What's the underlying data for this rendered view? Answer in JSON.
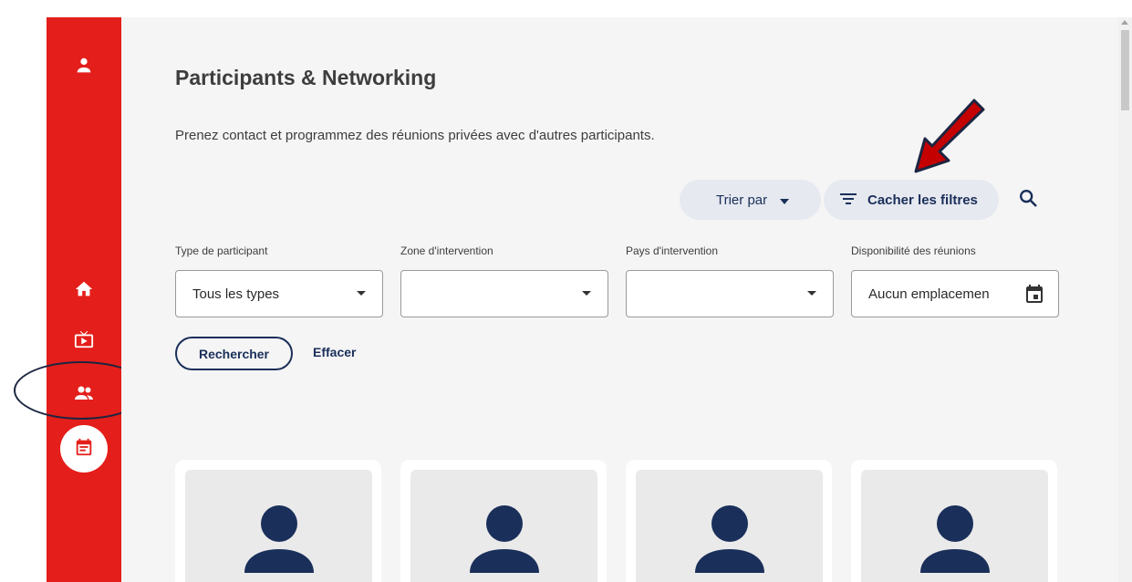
{
  "colors": {
    "brand_red": "#e41e1a",
    "navy": "#1a2f5a",
    "pill_bg": "#e6e9f0",
    "annotation_arrow": "#c40000"
  },
  "sidebar": {
    "icons": [
      "person-icon",
      "home-icon",
      "tv-icon",
      "people-icon",
      "calendar-icon"
    ],
    "active": "calendar-icon"
  },
  "page": {
    "title": "Participants & Networking",
    "subtitle": "Prenez contact et programmez des réunions privées avec d'autres participants."
  },
  "toolbar": {
    "sort_label": "Trier par",
    "filter_label": "Cacher les filtres",
    "search_icon": "search-icon"
  },
  "filters": {
    "type": {
      "label": "Type de participant",
      "value": "Tous les types"
    },
    "zone": {
      "label": "Zone d'intervention",
      "value": ""
    },
    "pays": {
      "label": "Pays d'intervention",
      "value": ""
    },
    "dispo": {
      "label": "Disponibilité des réunions",
      "value": "Aucun emplacemen"
    }
  },
  "actions": {
    "search_label": "Rechercher",
    "clear_label": "Effacer"
  },
  "participants": [
    {
      "avatar": "person-icon"
    },
    {
      "avatar": "person-icon"
    },
    {
      "avatar": "person-icon"
    },
    {
      "avatar": "person-icon"
    }
  ]
}
